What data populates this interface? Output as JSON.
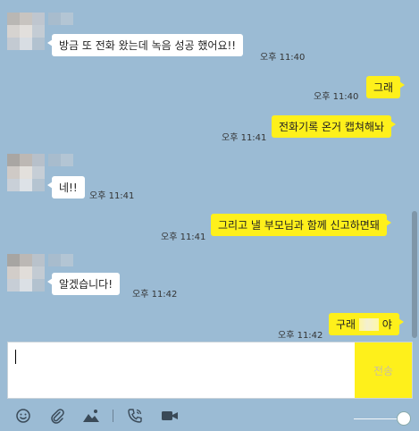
{
  "messages": [
    {
      "direction": "in",
      "text": "방금 또 전화 왔는데 녹음 성공 했어요!!",
      "time": "오후 11:40"
    },
    {
      "direction": "out",
      "text": "그래",
      "time": "오후 11:40"
    },
    {
      "direction": "out",
      "text": "전화기록 온거 캡쳐해놔",
      "time": "오후 11:41"
    },
    {
      "direction": "in",
      "text": "네!!",
      "time": "오후 11:41"
    },
    {
      "direction": "out",
      "text": "그리고 낼 부모님과 함께 신고하면돼",
      "time": "오후 11:41"
    },
    {
      "direction": "in",
      "text": "알겠습니다!",
      "time": "오후 11:42"
    },
    {
      "direction": "out",
      "text_start": "구래",
      "text_end": "야",
      "time": "오후 11:42"
    }
  ],
  "input": {
    "value": "",
    "send_label": "전송"
  },
  "toolbar": {
    "icons": [
      "emoticon-icon",
      "attach-icon",
      "photo-icon",
      "call-icon",
      "video-call-icon"
    ]
  },
  "colors": {
    "background": "#9bbbd4",
    "my_bubble": "#fef01b",
    "their_bubble": "#ffffff"
  }
}
